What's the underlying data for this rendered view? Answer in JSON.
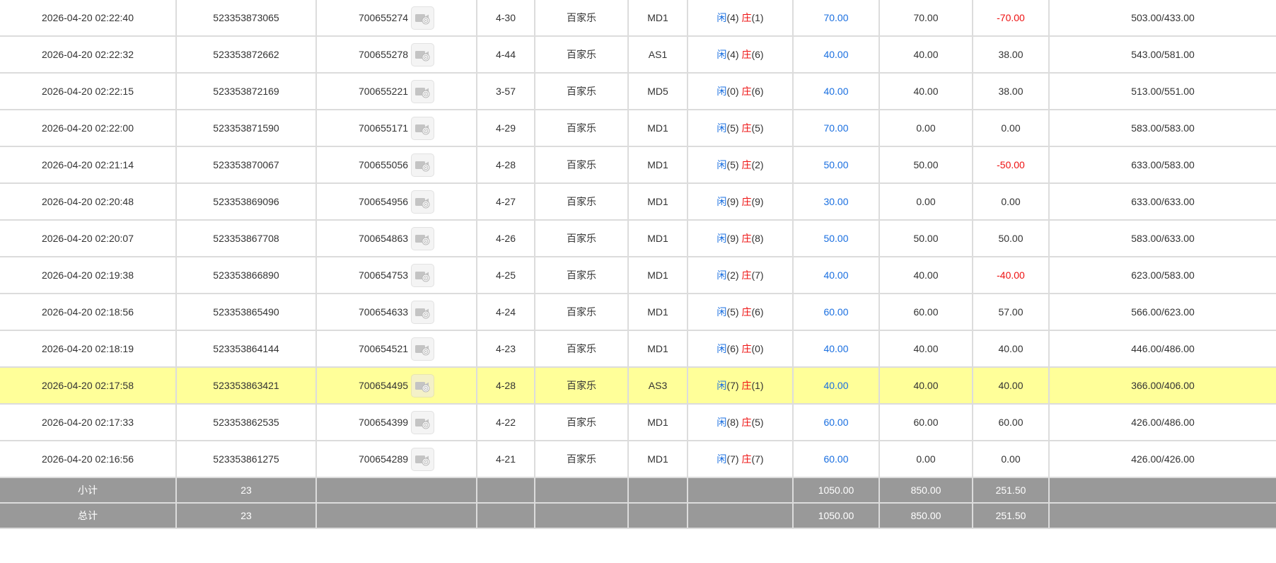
{
  "accent_colors": {
    "player": "#1a6fe0",
    "banker": "#ee1111",
    "negative": "#ee1111",
    "highlight_row": "#ffff99",
    "total_row": "#999999"
  },
  "replay_icon": "video-replay-icon",
  "rows": [
    {
      "time": "2026-04-20 02:22:40",
      "bet_no": "523353873065",
      "round_no": "700655274",
      "shoe": "4-30",
      "game": "百家乐",
      "table": "MD1",
      "player_label": "闲",
      "player_points": "(4)",
      "banker_label": "庄",
      "banker_points": "(1)",
      "bet_amount": "70.00",
      "valid_bet": "70.00",
      "win_loss": "-70.00",
      "negative": true,
      "balance": "503.00/433.00"
    },
    {
      "time": "2026-04-20 02:22:32",
      "bet_no": "523353872662",
      "round_no": "700655278",
      "shoe": "4-44",
      "game": "百家乐",
      "table": "AS1",
      "player_label": "闲",
      "player_points": "(4)",
      "banker_label": "庄",
      "banker_points": "(6)",
      "bet_amount": "40.00",
      "valid_bet": "40.00",
      "win_loss": "38.00",
      "negative": false,
      "balance": "543.00/581.00"
    },
    {
      "time": "2026-04-20 02:22:15",
      "bet_no": "523353872169",
      "round_no": "700655221",
      "shoe": "3-57",
      "game": "百家乐",
      "table": "MD5",
      "player_label": "闲",
      "player_points": "(0)",
      "banker_label": "庄",
      "banker_points": "(6)",
      "bet_amount": "40.00",
      "valid_bet": "40.00",
      "win_loss": "38.00",
      "negative": false,
      "balance": "513.00/551.00"
    },
    {
      "time": "2026-04-20 02:22:00",
      "bet_no": "523353871590",
      "round_no": "700655171",
      "shoe": "4-29",
      "game": "百家乐",
      "table": "MD1",
      "player_label": "闲",
      "player_points": "(5)",
      "banker_label": "庄",
      "banker_points": "(5)",
      "bet_amount": "70.00",
      "valid_bet": "0.00",
      "win_loss": "0.00",
      "negative": false,
      "balance": "583.00/583.00"
    },
    {
      "time": "2026-04-20 02:21:14",
      "bet_no": "523353870067",
      "round_no": "700655056",
      "shoe": "4-28",
      "game": "百家乐",
      "table": "MD1",
      "player_label": "闲",
      "player_points": "(5)",
      "banker_label": "庄",
      "banker_points": "(2)",
      "bet_amount": "50.00",
      "valid_bet": "50.00",
      "win_loss": "-50.00",
      "negative": true,
      "balance": "633.00/583.00"
    },
    {
      "time": "2026-04-20 02:20:48",
      "bet_no": "523353869096",
      "round_no": "700654956",
      "shoe": "4-27",
      "game": "百家乐",
      "table": "MD1",
      "player_label": "闲",
      "player_points": "(9)",
      "banker_label": "庄",
      "banker_points": "(9)",
      "bet_amount": "30.00",
      "valid_bet": "0.00",
      "win_loss": "0.00",
      "negative": false,
      "balance": "633.00/633.00"
    },
    {
      "time": "2026-04-20 02:20:07",
      "bet_no": "523353867708",
      "round_no": "700654863",
      "shoe": "4-26",
      "game": "百家乐",
      "table": "MD1",
      "player_label": "闲",
      "player_points": "(9)",
      "banker_label": "庄",
      "banker_points": "(8)",
      "bet_amount": "50.00",
      "valid_bet": "50.00",
      "win_loss": "50.00",
      "negative": false,
      "balance": "583.00/633.00"
    },
    {
      "time": "2026-04-20 02:19:38",
      "bet_no": "523353866890",
      "round_no": "700654753",
      "shoe": "4-25",
      "game": "百家乐",
      "table": "MD1",
      "player_label": "闲",
      "player_points": "(2)",
      "banker_label": "庄",
      "banker_points": "(7)",
      "bet_amount": "40.00",
      "valid_bet": "40.00",
      "win_loss": "-40.00",
      "negative": true,
      "balance": "623.00/583.00"
    },
    {
      "time": "2026-04-20 02:18:56",
      "bet_no": "523353865490",
      "round_no": "700654633",
      "shoe": "4-24",
      "game": "百家乐",
      "table": "MD1",
      "player_label": "闲",
      "player_points": "(5)",
      "banker_label": "庄",
      "banker_points": "(6)",
      "bet_amount": "60.00",
      "valid_bet": "60.00",
      "win_loss": "57.00",
      "negative": false,
      "balance": "566.00/623.00"
    },
    {
      "time": "2026-04-20 02:18:19",
      "bet_no": "523353864144",
      "round_no": "700654521",
      "shoe": "4-23",
      "game": "百家乐",
      "table": "MD1",
      "player_label": "闲",
      "player_points": "(6)",
      "banker_label": "庄",
      "banker_points": "(0)",
      "bet_amount": "40.00",
      "valid_bet": "40.00",
      "win_loss": "40.00",
      "negative": false,
      "balance": "446.00/486.00"
    },
    {
      "time": "2026-04-20 02:17:58",
      "bet_no": "523353863421",
      "round_no": "700654495",
      "shoe": "4-28",
      "game": "百家乐",
      "table": "AS3",
      "player_label": "闲",
      "player_points": "(7)",
      "banker_label": "庄",
      "banker_points": "(1)",
      "bet_amount": "40.00",
      "valid_bet": "40.00",
      "win_loss": "40.00",
      "negative": false,
      "balance": "366.00/406.00",
      "highlighted": true
    },
    {
      "time": "2026-04-20 02:17:33",
      "bet_no": "523353862535",
      "round_no": "700654399",
      "shoe": "4-22",
      "game": "百家乐",
      "table": "MD1",
      "player_label": "闲",
      "player_points": "(8)",
      "banker_label": "庄",
      "banker_points": "(5)",
      "bet_amount": "60.00",
      "valid_bet": "60.00",
      "win_loss": "60.00",
      "negative": false,
      "balance": "426.00/486.00"
    },
    {
      "time": "2026-04-20 02:16:56",
      "bet_no": "523353861275",
      "round_no": "700654289",
      "shoe": "4-21",
      "game": "百家乐",
      "table": "MD1",
      "player_label": "闲",
      "player_points": "(7)",
      "banker_label": "庄",
      "banker_points": "(7)",
      "bet_amount": "60.00",
      "valid_bet": "0.00",
      "win_loss": "0.00",
      "negative": false,
      "balance": "426.00/426.00"
    }
  ],
  "totals": [
    {
      "label": "小计",
      "count": "23",
      "bet_amount": "1050.00",
      "valid_bet": "850.00",
      "win_loss": "251.50"
    },
    {
      "label": "总计",
      "count": "23",
      "bet_amount": "1050.00",
      "valid_bet": "850.00",
      "win_loss": "251.50"
    }
  ]
}
